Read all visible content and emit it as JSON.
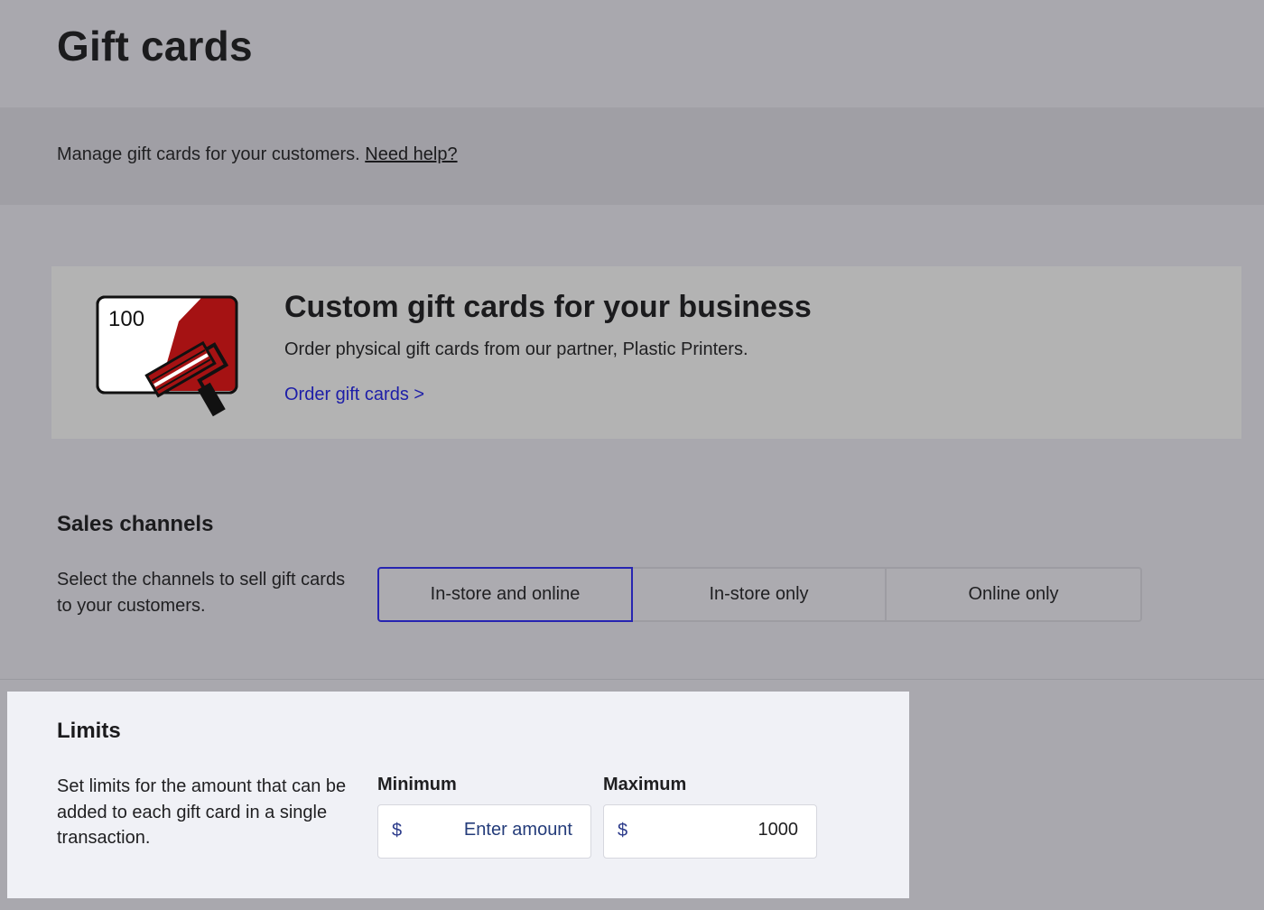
{
  "header": {
    "title": "Gift cards"
  },
  "description": {
    "text": "Manage gift cards for your customers.",
    "help_link": "Need help?"
  },
  "promo": {
    "illustration_value": "100",
    "heading": "Custom gift cards for your business",
    "subtext": "Order physical gift cards from our partner, Plastic Printers.",
    "link": "Order gift cards >",
    "colors": {
      "card_accent": "#a51213",
      "link": "#1d1ea8"
    }
  },
  "sales_channels": {
    "heading": "Sales channels",
    "description": "Select the channels to sell gift cards to your customers.",
    "options": [
      {
        "label": "In-store and online",
        "selected": true
      },
      {
        "label": "In-store only",
        "selected": false
      },
      {
        "label": "Online only",
        "selected": false
      }
    ],
    "selected_color": "#2725b1"
  },
  "limits": {
    "heading": "Limits",
    "description": "Set limits for the amount that can be added to each gift card in a single transaction.",
    "minimum": {
      "label": "Minimum",
      "currency": "$",
      "value": "",
      "placeholder": "Enter amount"
    },
    "maximum": {
      "label": "Maximum",
      "currency": "$",
      "value": "1000",
      "placeholder": ""
    }
  }
}
